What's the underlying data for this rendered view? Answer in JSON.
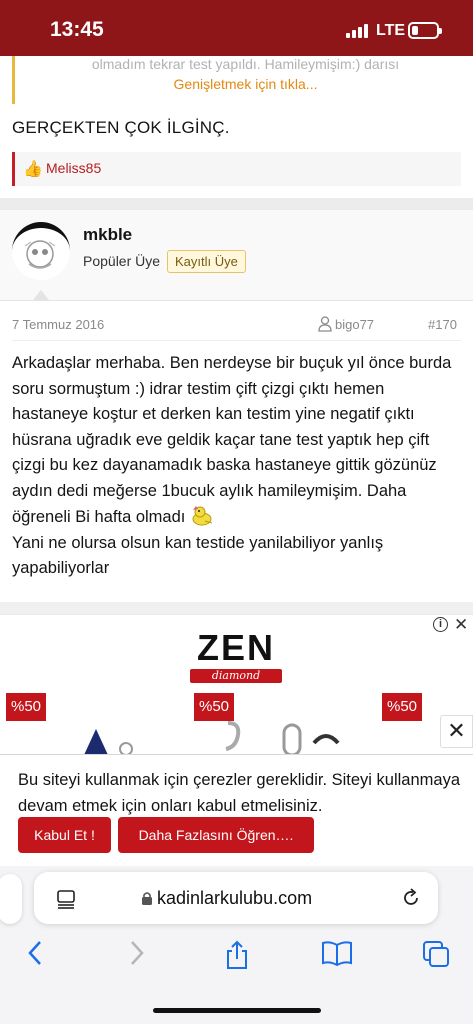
{
  "status_bar": {
    "time": "13:45",
    "network": "LTE"
  },
  "quote": {
    "faded_text": "olmadım tekrar test yapıldı. Hamileymişim:) darısı",
    "expand_label": "Genişletmek için tıkla..."
  },
  "previous_post": {
    "text": "GERÇEKTEN ÇOK İLGİNÇ.",
    "liked_by": "Meliss85"
  },
  "post": {
    "username": "mkble",
    "user_title": "Popüler Üye",
    "badge": "Kayıtlı Üye",
    "date": "7 Temmuz 2016",
    "author_tag": "bigo77",
    "number": "#170",
    "body": "Arkadaşlar merhaba. Ben nerdeyse bir buçuk yıl önce burda soru sormuştum :) idrar testim çift çizgi çıktı hemen hastaneye koştur et derken kan testim yine negatif çıktı hüsrana uğradık eve geldik kaçar tane test yaptık hep çift çizgi bu kez dayanamadık baska hastaneye gittik gözünüz aydın dedi meğerse 1bucuk aylık hamileymişim. Daha öğreneli Bi hafta olmadı",
    "body_end": "Yani ne olursa olsun kan testide yanilabiliyor yanlış yapabiliyorlar"
  },
  "ad": {
    "brand": "ZEN",
    "brand_sub": "diamond",
    "discounts": [
      "%50",
      "%50",
      "%50"
    ],
    "info_icon": "i",
    "close_icon": "✕",
    "collapse_icon": "✕"
  },
  "cookie": {
    "message": "Bu siteyi kullanmak için çerezler gereklidir. Siteyi kullanmaya devam etmek için onları kabul etmelisiniz.",
    "accept": "Kabul Et !",
    "learn_more": "Daha Fazlasını Öğren…."
  },
  "browser": {
    "url": "kadinlarkulubu.com"
  },
  "colors": {
    "brand": "#8e1518",
    "accent": "#c3161c",
    "quote_border": "#e8b93a",
    "expand_link": "#e08a12"
  }
}
